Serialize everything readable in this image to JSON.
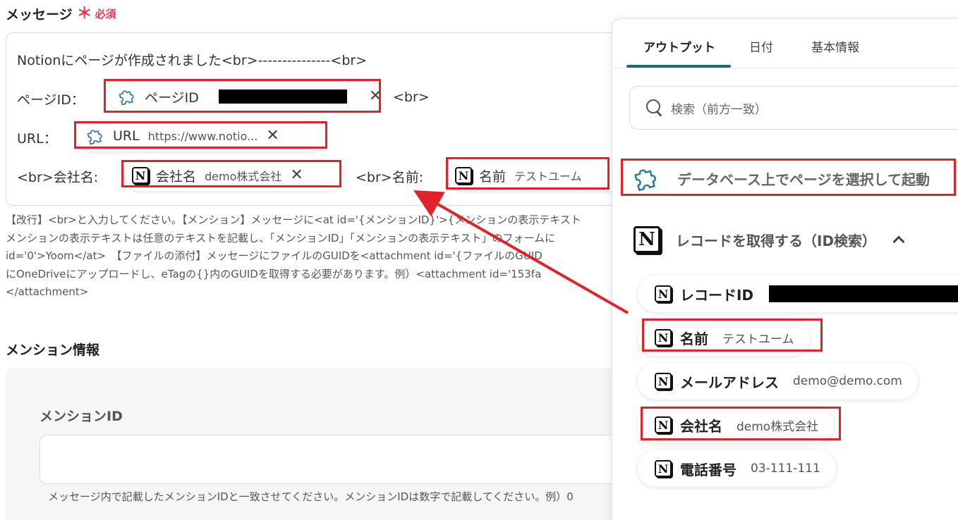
{
  "message": {
    "title": "メッセージ",
    "required_mark": "＊",
    "required_label": "必須",
    "line1": "Notionにページが作成されました<br>---------------<br>",
    "page_id_prefix": "ページID：",
    "page_id_chip_label": "ページID",
    "page_id_suffix": "<br>",
    "url_prefix": "URL：",
    "url_chip_label": "URL",
    "url_chip_value": "https://www.notio...",
    "company_prefix": "<br>会社名:",
    "company_chip_label": "会社名",
    "company_chip_value": "demo株式会社",
    "name_prefix": "<br>名前:",
    "name_chip_label": "名前",
    "name_chip_value": "テストユーム",
    "close_glyph": "✕"
  },
  "help_lines": [
    "【改行】<br>と入力してください。【メンション】メッセージに<at id='{メンションID}'>{メンションの表示テキスト",
    "メンションの表示テキストは任意のテキストを記載し、「メンションID」「メンションの表示テキスト」のフォームに",
    "id='0'>Yoom</at>　【ファイルの添付】メッセージにファイルのGUIDを<attachment id='{ファイルのGUID",
    "にOneDriveにアップロードし、eTagの{}内のGUIDを取得する必要があります。例）<attachment id='153fa",
    "</attachment>"
  ],
  "mention": {
    "title": "メンション情報",
    "id_label": "メンションID",
    "id_value": "",
    "id_help": "メッセージ内で記載したメンションIDと一致させてください。メンションIDは数字で記載してください。例）0"
  },
  "panel": {
    "tabs": [
      {
        "label": "アウトプット",
        "active": true
      },
      {
        "label": "日付",
        "active": false
      },
      {
        "label": "基本情報",
        "active": false
      }
    ],
    "search_placeholder": "検索（前方一致）",
    "trigger_label": "データベース上でページを選択して起動",
    "record_section_label": "レコードを取得する（ID検索）",
    "outputs": [
      {
        "label": "レコードID",
        "value": ""
      },
      {
        "label": "名前",
        "value": "テストユーム"
      },
      {
        "label": "メールアドレス",
        "value": "demo@demo.com"
      },
      {
        "label": "会社名",
        "value": "demo株式会社"
      },
      {
        "label": "電話番号",
        "value": "03-111-111"
      }
    ]
  },
  "icons": {
    "notion": "notion-icon",
    "puzzle": "puzzle-icon",
    "search": "search-icon",
    "close": "close-icon",
    "chevron": "chevron-up-icon",
    "notion_letter": "N"
  },
  "colors": {
    "required": "#e6394a",
    "highlight": "#e0232b",
    "tab_accent": "#1a6b78",
    "puzzle": "#2a7a8c"
  }
}
